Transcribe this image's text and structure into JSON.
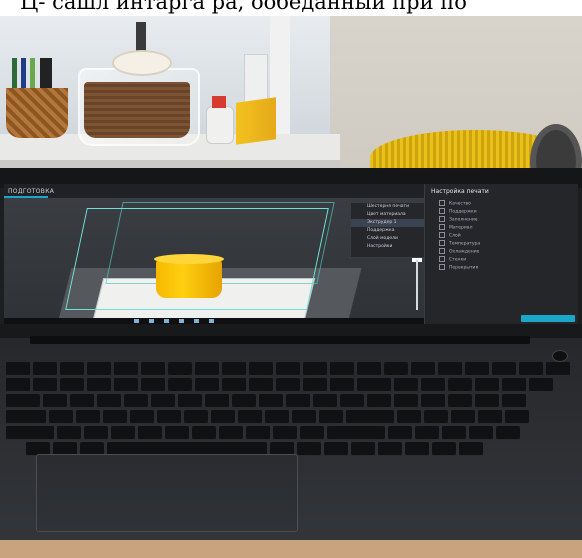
{
  "caption": {
    "text": "Ц- сашл интарга ра, ообеданный при по"
  },
  "slicer": {
    "mode_tab": "ПОДГОТОВКА",
    "objects_panel": {
      "items": [
        "Шестерня печати",
        "Цвет материала",
        "Экструдер 1",
        "Поддержка",
        "Слой модели",
        "Настройки",
        "Соединение"
      ]
    },
    "settings_panel": {
      "header": "Настройка печати",
      "rows": [
        "Качество",
        "Поддержки",
        "Заполнение",
        "Материал",
        "Слой",
        "Температура",
        "Охлаждение",
        "Стенки",
        "Перекрытия"
      ]
    }
  },
  "colors": {
    "model": "#ffc107",
    "cage": "#6fe0d8",
    "accent": "#1aa7c9",
    "spool": "#e8c21a"
  }
}
